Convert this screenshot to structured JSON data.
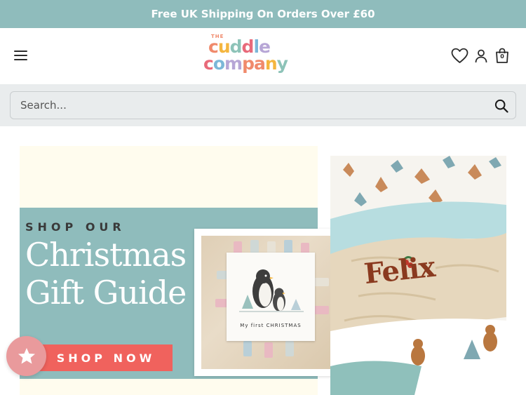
{
  "announcement": {
    "text": "Free UK Shipping On Orders Over £60"
  },
  "header": {
    "logo_the": "THE",
    "logo_line1": [
      "c",
      "u",
      "d",
      "d",
      "l",
      "e"
    ],
    "logo_line2": [
      "c",
      "o",
      "m",
      "p",
      "a",
      "n",
      "y"
    ],
    "logo_colors": [
      "#f08a6c",
      "#f4b63f",
      "#8dc3b8",
      "#e86a7a",
      "#7cb7d8",
      "#b7a6d6",
      "#f08a6c"
    ],
    "cart_count": "0",
    "icons": [
      "menu-icon",
      "heart-icon",
      "account-icon",
      "bag-icon"
    ]
  },
  "search": {
    "placeholder": "Search..."
  },
  "banner": {
    "kicker": "SHOP OUR",
    "title_line1": "Christmas",
    "title_line2": "Gift Guide",
    "cta": "SHOP NOW",
    "card_text": "My first CHRISTMAS"
  },
  "side_image": {
    "name_text": "Felix"
  },
  "colors": {
    "brand_teal": "#8fbcbc",
    "cta_red": "#f0625d",
    "reviews_pink": "#e99a9c"
  }
}
